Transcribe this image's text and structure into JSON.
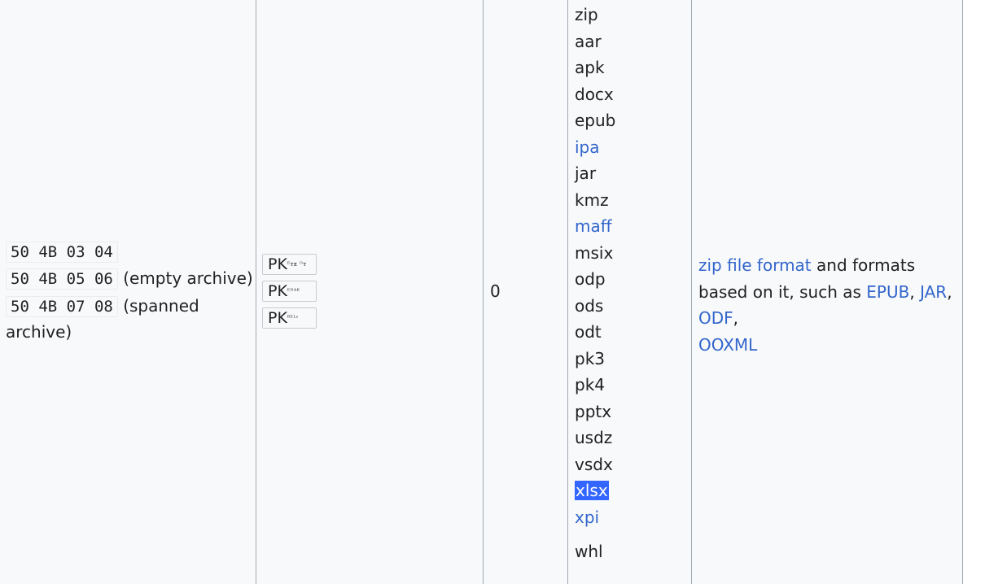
{
  "signatures": [
    {
      "hex": "50 4B 03 04",
      "note": ""
    },
    {
      "hex": "50 4B 05 06",
      "note": "(empty archive)"
    },
    {
      "hex": "50 4B 07 08",
      "note": "(spanned"
    },
    {
      "note_cont": "archive)"
    }
  ],
  "iso_boxes": [
    {
      "prefix": "PK",
      "glyphs": "ᴱᴛᴇ ᴼᴛ"
    },
    {
      "prefix": "PK",
      "glyphs": "ᴱᴺᴬᴷ"
    },
    {
      "prefix": "PK",
      "glyphs": "ᴮᴱᴸˢ"
    }
  ],
  "offset": "0",
  "extensions": [
    "zip",
    "aar",
    "apk",
    "docx",
    "epub",
    "ipa",
    "jar",
    "kmz",
    "maff",
    "msix",
    "odp",
    "ods",
    "odt",
    "pk3",
    "pk4",
    "pptx",
    "usdz",
    "vsdx",
    "xlsx",
    "xpi",
    "whl"
  ],
  "description": {
    "link1": "zip file format",
    "text1": " and formats based on it, such as ",
    "link2": "EPUB",
    "sep1": ", ",
    "link3": "JAR",
    "sep2": ", ",
    "link4": "ODF",
    "sep3": ",",
    "link5": "OOXML"
  },
  "colors": {
    "link": "#3366cc",
    "selection": "#3366ff",
    "cell_bg": "#f8f9fa",
    "border": "#a2a9b1"
  }
}
